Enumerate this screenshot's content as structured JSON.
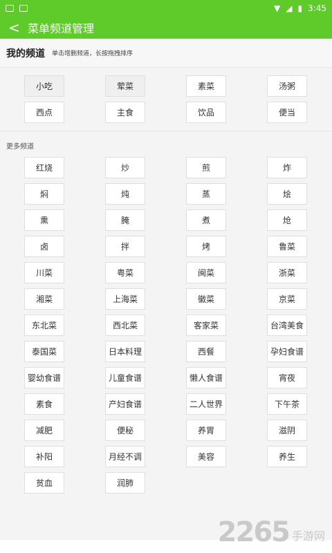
{
  "status": {
    "time": "3:45"
  },
  "appbar": {
    "title": "菜单频道管理"
  },
  "my": {
    "title": "我的频道",
    "hint": "单击增删频道，长按拖拽排序",
    "items": [
      "小吃",
      "荤菜",
      "素菜",
      "汤粥",
      "西点",
      "主食",
      "饮品",
      "便当"
    ]
  },
  "more": {
    "label": "更多频道",
    "items": [
      "红烧",
      "炒",
      "煎",
      "炸",
      "焖",
      "炖",
      "蒸",
      "烩",
      "熏",
      "腌",
      "煮",
      "炝",
      "卤",
      "拌",
      "烤",
      "鲁菜",
      "川菜",
      "粤菜",
      "闽菜",
      "浙菜",
      "湘菜",
      "上海菜",
      "徽菜",
      "京菜",
      "东北菜",
      "西北菜",
      "客家菜",
      "台湾美食",
      "泰国菜",
      "日本料理",
      "西餐",
      "孕妇食谱",
      "婴幼食谱",
      "儿童食谱",
      "懒人食谱",
      "宵夜",
      "素食",
      "产妇食谱",
      "二人世界",
      "下午茶",
      "减肥",
      "便秘",
      "养胃",
      "滋阴",
      "补阳",
      "月经不调",
      "美容",
      "养生",
      "贫血",
      "润肺"
    ]
  },
  "watermark": {
    "number": "2265",
    "text": "手游网"
  }
}
